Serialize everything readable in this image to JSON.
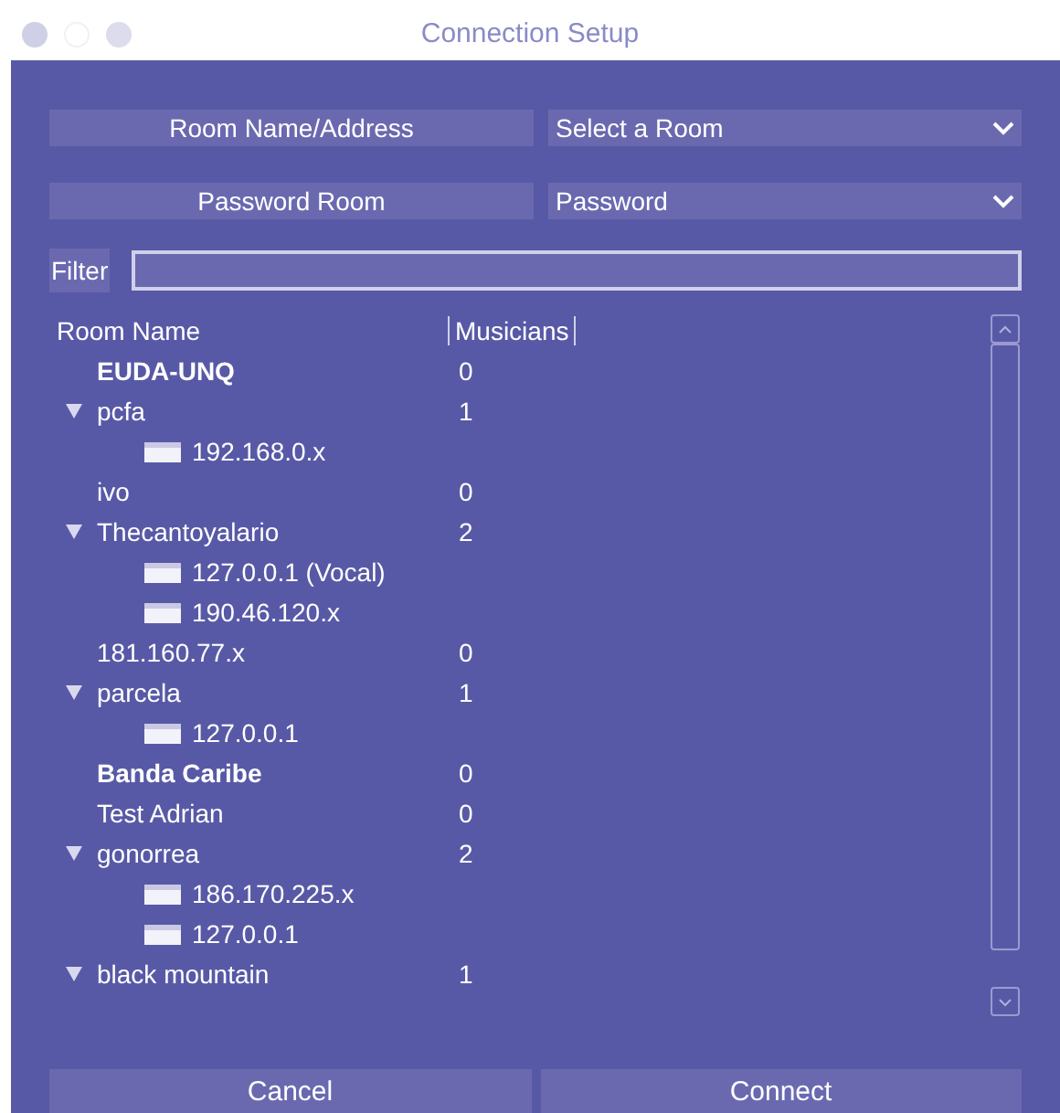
{
  "window": {
    "title": "Connection Setup"
  },
  "room_field": {
    "label": "Room Name/Address",
    "value": "Select a Room"
  },
  "password_field": {
    "label": "Password Room",
    "value": "Password"
  },
  "filter": {
    "label": "Filter"
  },
  "table": {
    "columns": [
      "Room Name",
      "Musicians"
    ],
    "rows": [
      {
        "name": "EUDA-UNQ",
        "musicians": "0",
        "bold": true
      },
      {
        "name": "pcfa",
        "musicians": "1",
        "bold": false,
        "expanded": true,
        "children": [
          {
            "name": "192.168.0.x"
          }
        ]
      },
      {
        "name": "ivo",
        "musicians": "0",
        "bold": false
      },
      {
        "name": "Thecantoyalario",
        "musicians": "2",
        "bold": false,
        "expanded": true,
        "children": [
          {
            "name": "127.0.0.1 (Vocal)"
          },
          {
            "name": "190.46.120.x"
          }
        ]
      },
      {
        "name": "181.160.77.x",
        "musicians": "0",
        "bold": false
      },
      {
        "name": "parcela",
        "musicians": "1",
        "bold": false,
        "expanded": true,
        "children": [
          {
            "name": "127.0.0.1"
          }
        ]
      },
      {
        "name": "Banda Caribe",
        "musicians": "0",
        "bold": true
      },
      {
        "name": "Test Adrian",
        "musicians": "0",
        "bold": false
      },
      {
        "name": "gonorrea",
        "musicians": "2",
        "bold": false,
        "expanded": true,
        "children": [
          {
            "name": "186.170.225.x"
          },
          {
            "name": "127.0.0.1"
          }
        ]
      },
      {
        "name": "black mountain",
        "musicians": "1",
        "bold": false,
        "expanded": true
      }
    ]
  },
  "buttons": [
    "Cancel",
    "Connect"
  ]
}
